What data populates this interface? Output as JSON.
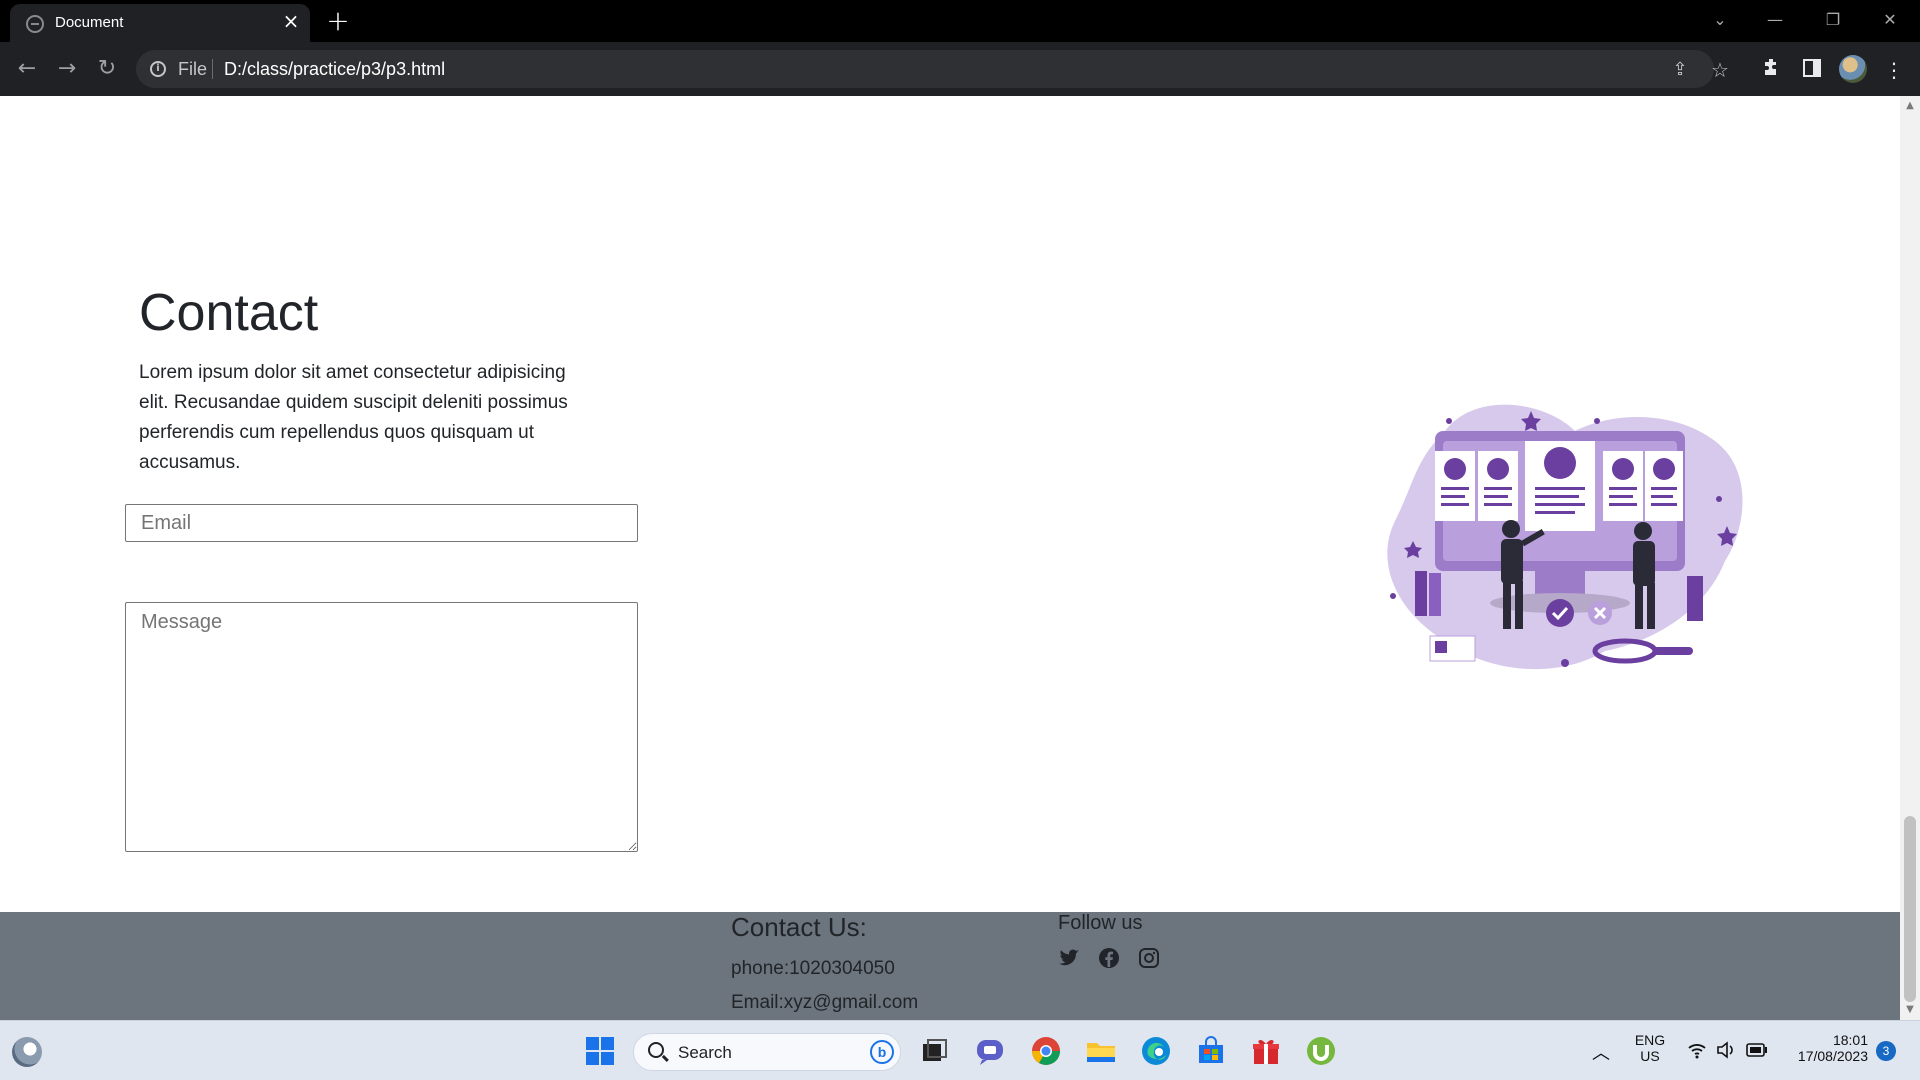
{
  "browser": {
    "tab_title": "Document",
    "omnibox_scheme": "File",
    "omnibox_url": "D:/class/practice/p3/p3.html"
  },
  "contact": {
    "title": "Contact",
    "description": "Lorem ipsum dolor sit amet consectetur adipisicing elit. Recusandae quidem suscipit deleniti possimus perferendis cum repellendus quos quisquam ut accusamus.",
    "email_placeholder": "Email",
    "message_placeholder": "Message"
  },
  "footer": {
    "heading": "Contact Us:",
    "phone": "phone:1020304050",
    "email": "Email:xyz@gmail.com",
    "follow_title": "Follow us",
    "social_icons": [
      "twitter-icon",
      "facebook-icon",
      "instagram-icon"
    ]
  },
  "taskbar": {
    "search_label": "Search",
    "language_top": "ENG",
    "language_bottom": "US",
    "time": "18:01",
    "date": "17/08/2023",
    "notification_count": "3"
  },
  "colors": {
    "footer_bg": "#6c757d",
    "illustration_accent": "#6b3fa0",
    "illustration_light": "#d7c9ec"
  }
}
